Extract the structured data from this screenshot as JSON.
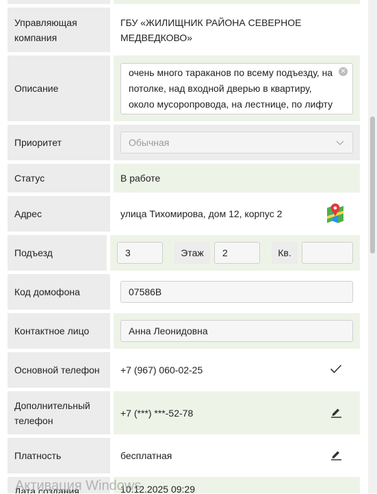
{
  "rows": {
    "company": {
      "label": "Управляющая компания",
      "value": "ГБУ «ЖИЛИЩНИК РАЙОНА СЕВЕРНОЕ МЕДВЕДКОВО»"
    },
    "description": {
      "label": "Описание",
      "value": "очень много тараканов по всему подъезду, на потолке, над входной дверью в квартиру, около мусоропровода, на лестнице, по лифту ползают"
    },
    "priority": {
      "label": "Приоритет",
      "placeholder": "Обычная"
    },
    "status": {
      "label": "Статус",
      "value": "В работе"
    },
    "address": {
      "label": "Адрес",
      "value": "улица Тихомирова, дом 12, корпус 2"
    },
    "entrance": {
      "label": "Подъезд",
      "value": "3",
      "floor_label": "Этаж",
      "floor_value": "2",
      "apt_label": "Кв.",
      "apt_value": ""
    },
    "intercom": {
      "label": "Код домофона",
      "value": "07586В"
    },
    "contact": {
      "label": "Контактное лицо",
      "value": "Анна Леонидовна"
    },
    "main_phone": {
      "label": "Основной телефон",
      "value": "+7 (967) 060-02-25"
    },
    "extra_phone": {
      "label": "Дополнительный телефон",
      "value": "+7 (***) ***-52-78"
    },
    "payment": {
      "label": "Платность",
      "value": "бесплатная"
    },
    "created": {
      "label": "Дата создания",
      "value": "10.12.2025 09:29"
    }
  },
  "watermark": "Активация Windows",
  "icons": {
    "map": "map-pin-icon",
    "check": "check-icon",
    "edit": "pencil-icon",
    "dropdown": "chevron-down-icon",
    "clear": "clear-x-icon"
  },
  "colors": {
    "label_bg": "#ececec",
    "value_bg": "#eef3e8"
  }
}
